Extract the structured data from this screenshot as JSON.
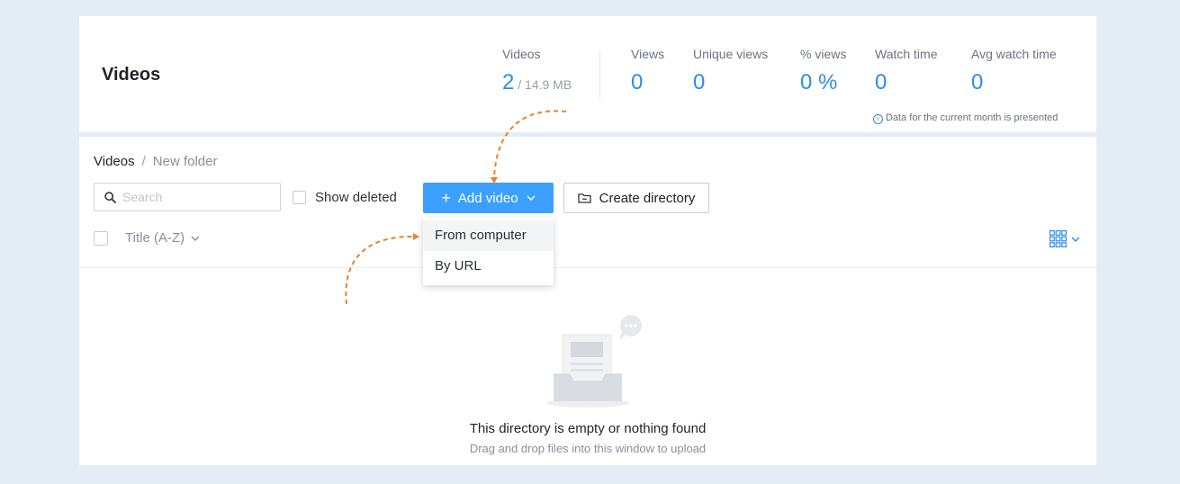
{
  "header": {
    "title": "Videos",
    "stats": [
      {
        "label": "Videos",
        "value": "2",
        "sub": " / 14.9 MB"
      },
      {
        "label": "Views",
        "value": "0"
      },
      {
        "label": "Unique views",
        "value": "0"
      },
      {
        "label": "% views",
        "value": "0 %"
      },
      {
        "label": "Watch time",
        "value": "0"
      },
      {
        "label": "Avg watch time",
        "value": "0"
      }
    ],
    "note": "Data for the current month is presented",
    "accent_color": "#2d8cf0"
  },
  "breadcrumb": {
    "root": "Videos",
    "separator": "/",
    "current": "New folder"
  },
  "toolbar": {
    "search_placeholder": "Search",
    "show_deleted_label": "Show deleted",
    "add_video_label": "Add video",
    "create_directory_label": "Create directory",
    "add_button_color": "#3ba0ff"
  },
  "dropdown": {
    "items": [
      "From computer",
      "By URL"
    ]
  },
  "sort": {
    "label": "Title (A-Z)"
  },
  "empty": {
    "title": "This directory is empty or nothing found",
    "subtitle": "Drag and drop files into this window to upload"
  },
  "icons": [
    "search-icon",
    "plus-icon",
    "chevron-down-icon",
    "folder-icon",
    "grid-view-icon",
    "info-icon",
    "empty-inbox-illustration"
  ]
}
